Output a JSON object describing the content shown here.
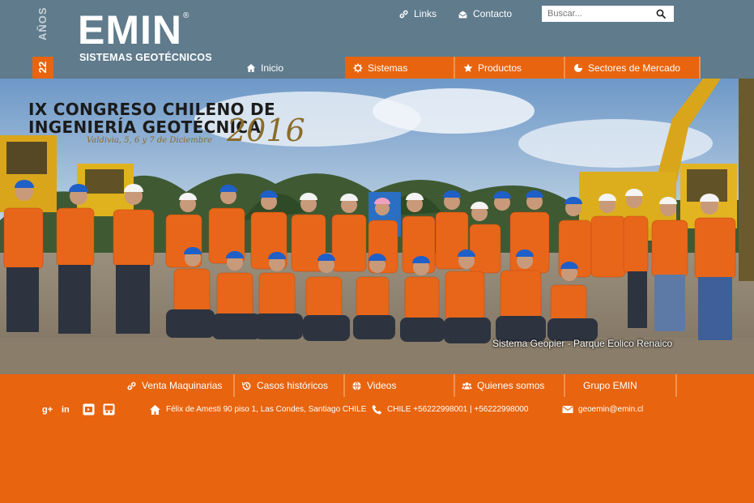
{
  "header": {
    "anios_number": "22",
    "anios_label": "AÑOS",
    "logo_wordmark": "EMIN",
    "logo_registered": "®",
    "logo_subtitle": "SISTEMAS GEOTÉCNICOS",
    "top_links": [
      {
        "label": "Links",
        "icon": "link-icon"
      },
      {
        "label": "Contacto",
        "icon": "mail-open-icon"
      }
    ],
    "search": {
      "placeholder": "Buscar...",
      "value": ""
    }
  },
  "main_nav": {
    "items": [
      {
        "label": "Inicio",
        "icon": "home-icon"
      },
      {
        "label": "Sistemas",
        "icon": "gear-icon"
      },
      {
        "label": "Productos",
        "icon": "star-icon"
      },
      {
        "label": "Sectores de Mercado",
        "icon": "pie-chart-icon"
      }
    ]
  },
  "hero": {
    "title_line1": "IX CONGRESO CHILENO DE",
    "title_line2": "INGENIERÍA GEOTÉCNICA",
    "year": "2016",
    "subtitle": "Valdivia, 5, 6 y 7 de Diciembre",
    "caption": "Sistema Geopier - Parque Eolico Renaico"
  },
  "bottom_nav": {
    "items": [
      {
        "label": "Venta Maquinarias",
        "icon": "link-icon"
      },
      {
        "label": "Casos históricos",
        "icon": "history-icon"
      },
      {
        "label": "Videos",
        "icon": "globe-icon"
      },
      {
        "label": "Quienes somos",
        "icon": "group-icon"
      },
      {
        "label": "Grupo EMIN",
        "icon": ""
      }
    ]
  },
  "footer": {
    "social": [
      "google-plus-icon",
      "linkedin-icon",
      "youtube-icon",
      "slideshare-icon"
    ],
    "address": "Félix de Amesti 90 piso 1, Las Condes, Santiago CHILE",
    "phone": "CHILE +56222998001 | +56222998000",
    "email": "geoemin@emin.cl"
  },
  "colors": {
    "header_bg": "#5f7b8c",
    "accent_orange": "#e8640f",
    "separator": "#f0924f"
  }
}
